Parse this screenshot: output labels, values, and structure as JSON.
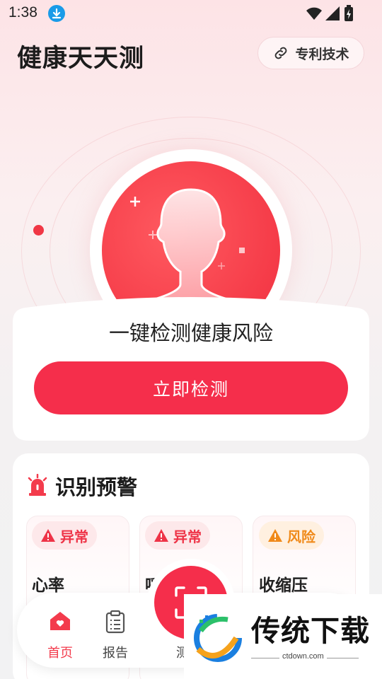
{
  "status_bar": {
    "time": "1:38"
  },
  "header": {
    "app_title": "健康天天测",
    "patent_label": "专利技术"
  },
  "hero": {
    "detect_text": "一键检测健康风险",
    "detect_button": "立即检测"
  },
  "warnings": {
    "title": "识别预警",
    "cards": [
      {
        "badge": "异常",
        "badge_color": "#ee3347",
        "name": "心率"
      },
      {
        "badge": "异常",
        "badge_color": "#ee3347",
        "name": "呼"
      },
      {
        "badge": "风险",
        "badge_color": "#f08a1a",
        "name": "收缩压"
      }
    ]
  },
  "tab_bar": {
    "tabs": [
      {
        "label": "首页",
        "icon": "home-icon",
        "active": true
      },
      {
        "label": "报告",
        "icon": "clipboard-icon",
        "active": false
      },
      {
        "label": "测",
        "icon": "scan-icon",
        "active": false
      }
    ]
  },
  "watermark": {
    "text": "传统下载",
    "url": "ctdown.com"
  },
  "colors": {
    "accent": "#f52e4b",
    "warning_red": "#ee3347",
    "warning_orange": "#f08a1a"
  }
}
